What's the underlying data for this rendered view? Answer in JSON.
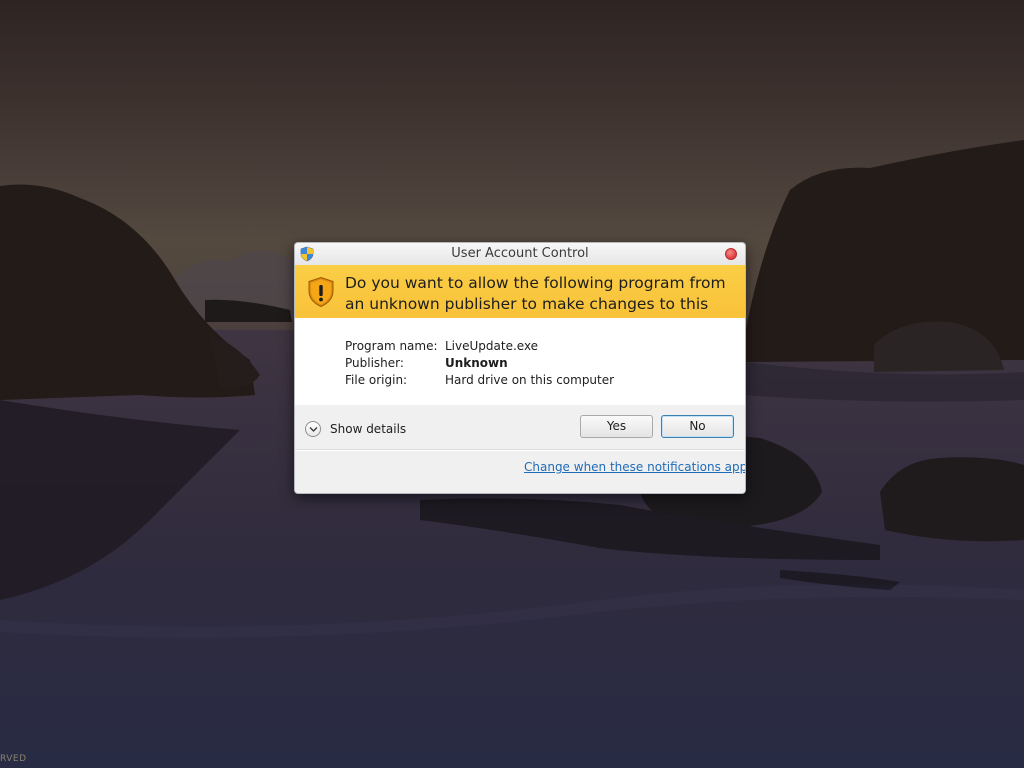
{
  "desktop": {
    "corner_text": "RVED"
  },
  "dialog": {
    "title": "User Account Control",
    "banner_question": "Do you want to allow the following program from an unknown publisher to make changes to this computer?",
    "details": [
      {
        "label": "Program name:",
        "value": "LiveUpdate.exe",
        "bold": false
      },
      {
        "label": "Publisher:",
        "value": "Unknown",
        "bold": true
      },
      {
        "label": "File origin:",
        "value": "Hard drive on this computer",
        "bold": false
      }
    ],
    "show_details_label": "Show details",
    "yes_label": "Yes",
    "no_label": "No",
    "notifications_link": "Change when these notifications appear",
    "banner_color": "#f9c63f",
    "link_color": "#1f6cb8",
    "icons": {
      "title": "uac-shield-icon",
      "banner": "warning-shield-icon",
      "toggle": "chevron-down-icon",
      "close": "close-icon"
    }
  }
}
